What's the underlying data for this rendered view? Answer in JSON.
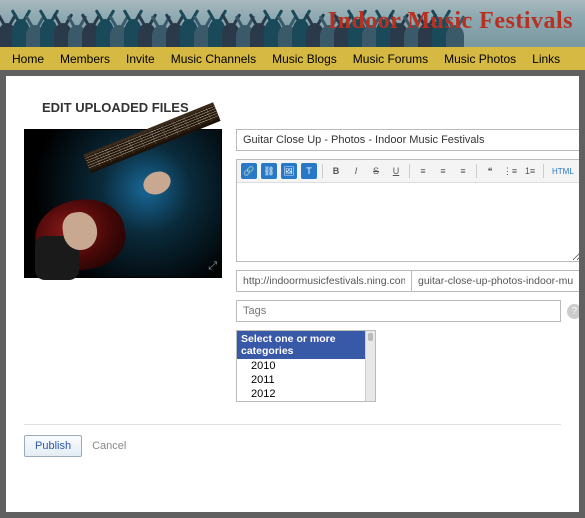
{
  "site_title": "Indoor Music Festivals",
  "nav": [
    "Home",
    "Members",
    "Invite",
    "Music Channels",
    "Music Blogs",
    "Music Forums",
    "Music Photos",
    "Links"
  ],
  "page_title": "EDIT UPLOADED FILES",
  "form": {
    "title_value": "Guitar Close Up - Photos - Indoor Music Festivals",
    "url_base": "http://indoormusicfestivals.ning.com/photos/",
    "url_slug": "guitar-close-up-photos-indoor-mu",
    "tags_placeholder": "Tags",
    "categories_header": "Select one or more categories",
    "categories": [
      "2010",
      "2011",
      "2012"
    ]
  },
  "toolbar": {
    "link": "Link",
    "unlink": "Unlink",
    "image": "Image",
    "embed": "Embed",
    "bold": "B",
    "italic": "I",
    "strike": "S",
    "underline": "U",
    "left": "Left",
    "center": "Center",
    "right": "Right",
    "quote": "Quote",
    "ul": "Bulleted",
    "ol": "Numbered",
    "html": "HTML"
  },
  "actions": {
    "publish": "Publish",
    "cancel": "Cancel"
  },
  "icons": {
    "expand": "⤢",
    "help": "?"
  }
}
